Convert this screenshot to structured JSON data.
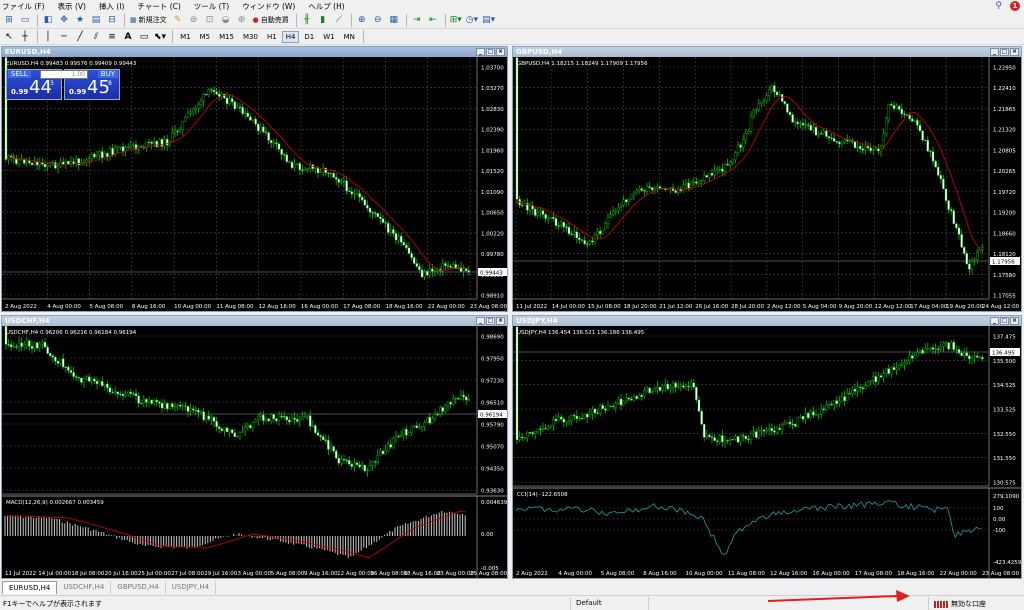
{
  "menu": [
    "ファイル (F)",
    "表示 (V)",
    "挿入 (I)",
    "チャート (C)",
    "ツール (T)",
    "ウィンドウ (W)",
    "ヘルプ (H)"
  ],
  "notification_count": "1",
  "toolbar": {
    "new_order_label": "新規注文",
    "autotrade_label": "自動売買",
    "timeframes": [
      "M1",
      "M5",
      "M15",
      "M30",
      "H1",
      "H4",
      "D1",
      "W1",
      "MN"
    ],
    "active_timeframe": "H4"
  },
  "charts": {
    "eurusd": {
      "title": "EURUSD,H4",
      "info": "EURUSD,H4  0.99483 0.99576 0.99409 0.99443",
      "current_price": "0.99443",
      "price_ticks": [
        "1.03700",
        "1.03270",
        "1.02830",
        "1.02390",
        "1.01960",
        "1.01520",
        "1.01090",
        "1.00650",
        "1.00220",
        "0.99780",
        "0.99350",
        "0.98910"
      ],
      "time_ticks": [
        "2 Aug 2022",
        "4 Aug 00:00",
        "5 Aug 08:00",
        "8 Aug 16:00",
        "10 Aug 00:00",
        "11 Aug 08:00",
        "12 Aug 16:00",
        "16 Aug 00:00",
        "17 Aug 08:00",
        "18 Aug 16:00",
        "22 Aug 00:00",
        "23 Aug 08:00"
      ],
      "trade": {
        "sell_label": "SELL",
        "buy_label": "BUY",
        "lot": "1.00",
        "sell_small": "0.99",
        "sell_big": "44",
        "sell_sup": "3",
        "buy_small": "0.99",
        "buy_big": "45",
        "buy_sup": "8"
      }
    },
    "gbpusd": {
      "title": "GBPUSD,H4",
      "info": "GBPUSD,H4  1.18215 1.18249 1.17909 1.17956",
      "current_price": "1.17956",
      "price_ticks": [
        "1.22950",
        "1.22410",
        "1.21865",
        "1.21320",
        "1.20805",
        "1.20265",
        "1.19720",
        "1.19200",
        "1.18660",
        "1.18120",
        "1.17580",
        "1.17055"
      ],
      "time_ticks": [
        "11 Jul 2022",
        "14 Jul 00:00",
        "15 Jul 08:00",
        "18 Jul 20:00",
        "21 Jul 12:00",
        "26 Jul 16:00",
        "28 Jul 20:00",
        "2 Aug 12:00",
        "5 Aug 04:00",
        "9 Aug 20:00",
        "12 Aug 12:00",
        "17 Aug 04:00",
        "19 Aug 20:00",
        "24 Aug 12:00"
      ]
    },
    "usdchf": {
      "title": "USDCHF,H4",
      "info": "USDCHF,H4  0.96206 0.96216 0.96184 0.96194",
      "current_price": "0.96194",
      "price_ticks": [
        "0.98690",
        "0.97950",
        "0.97230",
        "0.96510",
        "0.95790",
        "0.95070",
        "0.94350",
        "0.93630"
      ],
      "macd_label": "MACD(12,26,9) 0.002667 0.003459",
      "macd_ticks": [
        "0.004639",
        "0.00",
        "-0.005"
      ],
      "time_ticks": [
        "11 Jul 2022",
        "14 Jul 00:00",
        "18 Jul 08:00",
        "20 Jul 16:00",
        "25 Jul 00:00",
        "27 Jul 08:00",
        "29 Jul 16:00",
        "3 Aug 00:00",
        "5 Aug 08:00",
        "9 Aug 16:00",
        "12 Aug 00:00",
        "16 Aug 08:00",
        "18 Aug 16:00",
        "23 Aug 00:00",
        "25 Aug 08:00"
      ]
    },
    "usdjpy": {
      "title": "USDJPY,H4",
      "info": "USDJPY,H4  136.454 136.521 136.186 136.495",
      "current_price": "136.495",
      "price_ticks": [
        "137.475",
        "135.500",
        "134.525",
        "133.525",
        "132.550",
        "131.550",
        "130.575"
      ],
      "cci_label": "CCI(14) -122.6508",
      "cci_ticks": [
        "279.1090",
        "100",
        "0.00",
        "-100",
        "-423.4259"
      ],
      "time_ticks": [
        "2 Aug 2022",
        "4 Aug 00:00",
        "5 Aug 08:00",
        "8 Aug 16:00",
        "10 Aug 00:00",
        "11 Aug 08:00",
        "12 Aug 16:00",
        "16 Aug 00:00",
        "17 Aug 08:00",
        "18 Aug 16:00",
        "22 Aug 00:00",
        "23 Aug 08:00"
      ]
    }
  },
  "tabs": [
    "EURUSD,H4",
    "USDCHF,H4",
    "GBPUSD,H4",
    "USDJPY,H4"
  ],
  "status": {
    "help": "F1キーでヘルプが表示されます",
    "profile": "Default",
    "connection": "無効な口座"
  },
  "colors": {
    "candle": "#00c000",
    "bull": "#ffffff",
    "ma": "#c00000",
    "grid": "#4a4a4a",
    "arrow": "#e02020",
    "cci": "#20a0a0"
  }
}
